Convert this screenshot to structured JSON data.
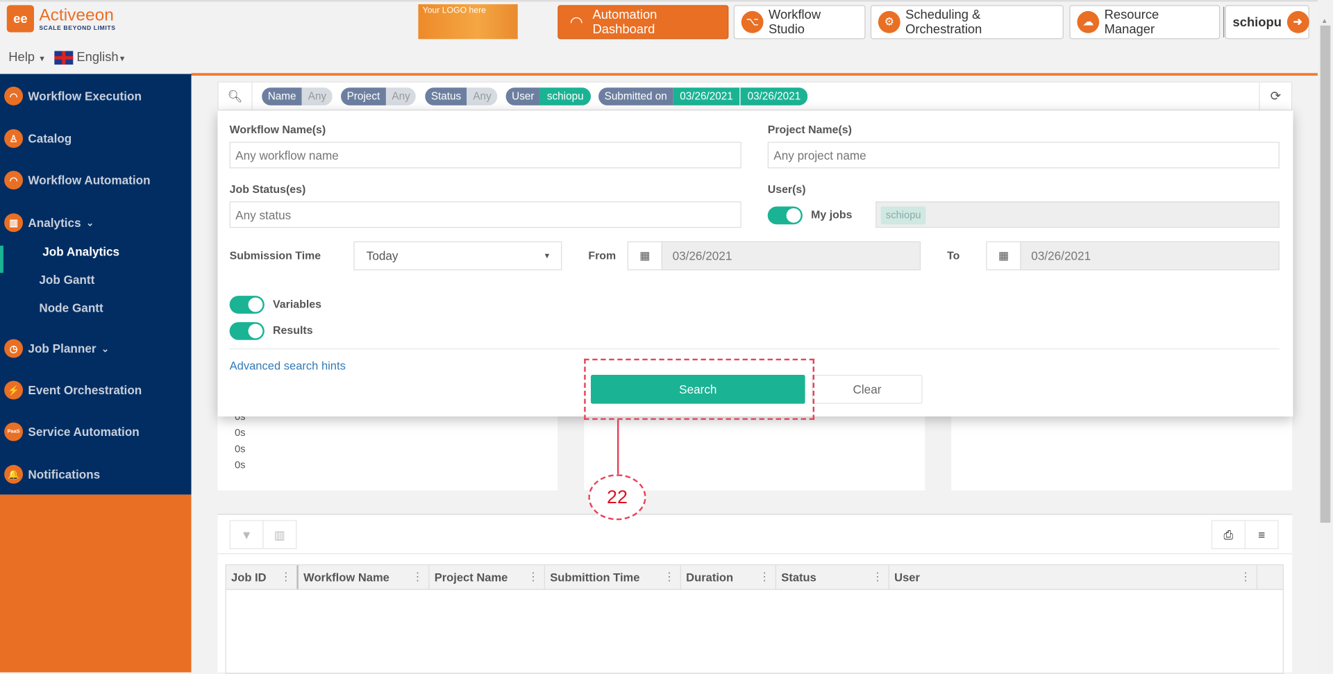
{
  "header": {
    "logo_text": "Activeeon",
    "logo_tagline": "SCALE BEYOND LIMITS",
    "help": "Help",
    "language": "English",
    "custom_logo": "Your LOGO here",
    "nav": [
      {
        "label": "Automation Dashboard",
        "icon": "gauge-icon",
        "active": true
      },
      {
        "label": "Workflow Studio",
        "icon": "workflow-icon"
      },
      {
        "label": "Scheduling & Orchestration",
        "icon": "gears-icon"
      },
      {
        "label": "Resource Manager",
        "icon": "cloud-icon"
      }
    ],
    "user": "schiopu",
    "accent": "#e96f24"
  },
  "sidebar": {
    "items": [
      {
        "label": "Workflow Execution",
        "icon": "gauge-icon"
      },
      {
        "label": "Catalog",
        "icon": "catalog-icon"
      },
      {
        "label": "Workflow Automation",
        "icon": "gauge-icon"
      },
      {
        "label": "Analytics",
        "icon": "chart-icon",
        "expanded": true
      },
      {
        "label": "Job Planner",
        "icon": "clock-icon"
      },
      {
        "label": "Event Orchestration",
        "icon": "pulse-icon"
      },
      {
        "label": "Service Automation",
        "icon": "paas-icon"
      },
      {
        "label": "Notifications",
        "icon": "bell-icon"
      }
    ],
    "subitems": [
      "Job Analytics",
      "Job Gantt",
      "Node Gantt"
    ],
    "active_subitem": "Job Analytics",
    "background": "#012d62"
  },
  "filterbar": {
    "chips": [
      {
        "key": "Name",
        "value": "Any"
      },
      {
        "key": "Project",
        "value": "Any"
      },
      {
        "key": "Status",
        "value": "Any"
      },
      {
        "key": "User",
        "value": "schiopu"
      },
      {
        "key": "Submitted on",
        "from": "03/26/2021",
        "to": "03/26/2021"
      }
    ]
  },
  "search_panel": {
    "workflow_label": "Workflow Name(s)",
    "workflow_placeholder": "Any workflow name",
    "project_label": "Project Name(s)",
    "project_placeholder": "Any project name",
    "status_label": "Job Status(es)",
    "status_placeholder": "Any status",
    "users_label": "User(s)",
    "my_jobs_label": "My jobs",
    "my_jobs_on": true,
    "user_chip": "schiopu",
    "submission_label": "Submission Time",
    "submission_value": "Today",
    "from_label": "From",
    "from_value": "03/26/2021",
    "to_label": "To",
    "to_value": "03/26/2021",
    "variables_label": "Variables",
    "variables_on": true,
    "results_label": "Results",
    "results_on": true,
    "hints_link": "Advanced search hints",
    "search_button": "Search",
    "clear_button": "Clear"
  },
  "cards": {
    "duration_ticks": [
      "0s",
      "0s",
      "0s",
      "0s"
    ]
  },
  "table": {
    "columns": [
      "Job ID",
      "Workflow Name",
      "Project Name",
      "Submittion Time",
      "Duration",
      "Status",
      "User"
    ],
    "rows": []
  },
  "annotation": {
    "label": "22",
    "color": "#e8425a"
  }
}
